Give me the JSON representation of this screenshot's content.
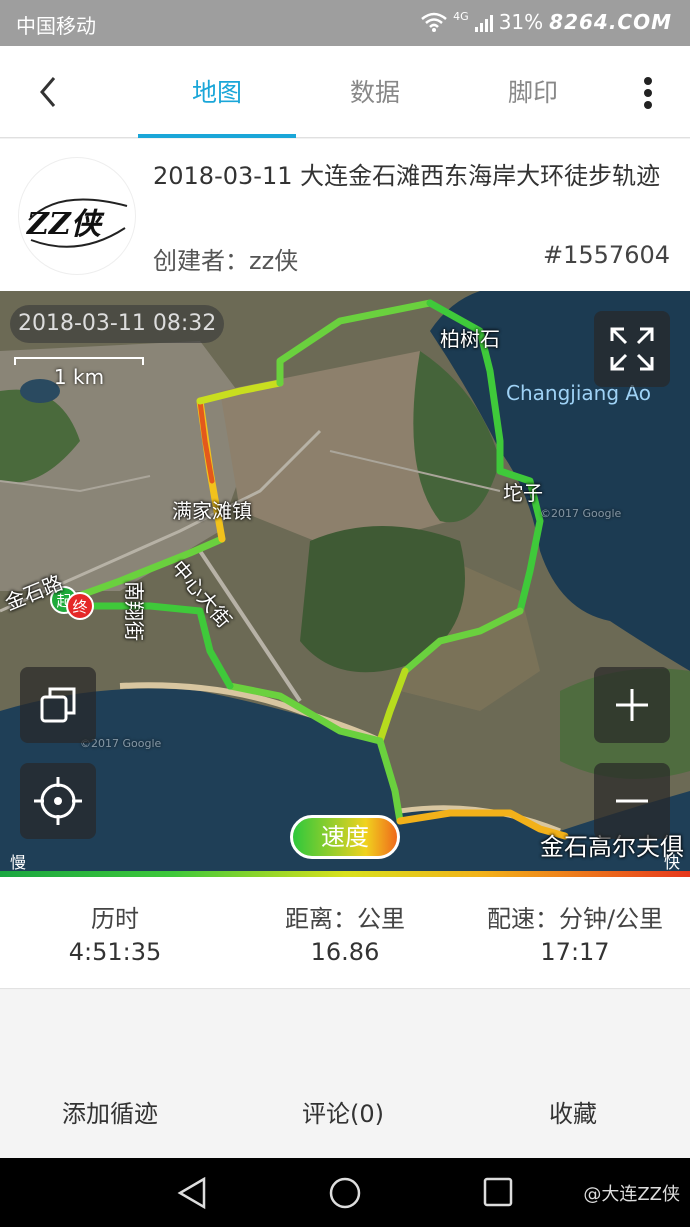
{
  "status_bar": {
    "carrier": "中国移动",
    "network": "4G",
    "battery": "31%",
    "watermark": "8264.COM"
  },
  "app_bar": {
    "tabs": [
      {
        "label": "地图",
        "active": true
      },
      {
        "label": "数据",
        "active": false
      },
      {
        "label": "脚印",
        "active": false
      }
    ]
  },
  "track": {
    "title": "2018-03-11 大连金石滩西东海岸大环徒步轨迹",
    "creator": "创建者：zz侠",
    "id": "#1557604",
    "avatar_text": "ZZ侠"
  },
  "map": {
    "timestamp": "2018-03-11 08:32",
    "scale": "1 km",
    "speed_button": "速度",
    "legend_slow": "慢",
    "legend_fast": "快",
    "start_marker": "起",
    "end_marker": "终",
    "labels": {
      "baishishi": "柏树石",
      "changjiang_ao": "Changjiang Ao",
      "tuozi": "坨子",
      "manjiatan": "满家滩镇",
      "zhongxin": "中心大街",
      "nanxiu": "南翔街",
      "jinshi_road": "金石路",
      "golf": "金石高尔夫俱",
      "copyright1": "©2017 Google",
      "copyright2": "©2017 Google"
    }
  },
  "stats": [
    {
      "label": "历时",
      "value": "4:51:35"
    },
    {
      "label": "距离：公里",
      "value": "16.86"
    },
    {
      "label": "配速：分钟/公里",
      "value": "17:17"
    }
  ],
  "actions": {
    "add": "添加循迹",
    "comment": "评论(0)",
    "favorite": "收藏"
  },
  "nav": {
    "watermark": "@大连ZZ侠"
  },
  "colors": {
    "accent": "#1aa6d8",
    "track_slow": "#2ec83c",
    "track_mid": "#f0d21e",
    "track_fast": "#e6371c"
  }
}
